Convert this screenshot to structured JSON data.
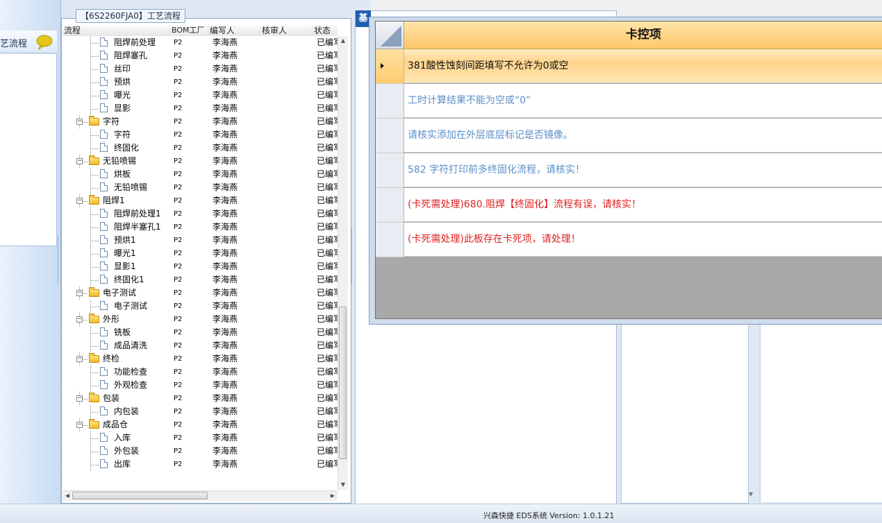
{
  "left_nav": {
    "item_label": "艺流程"
  },
  "process_panel": {
    "title": "【6S2260FJA0】工艺流程",
    "columns": [
      "流程",
      "BOM工厂",
      "编写人",
      "核审人",
      "状态"
    ],
    "rows": [
      {
        "type": "leaf",
        "label": "阻焊前处理",
        "bom": "P2",
        "writer": "李海燕",
        "status": "已编写"
      },
      {
        "type": "leaf",
        "label": "阻焊塞孔",
        "bom": "P2",
        "writer": "李海燕",
        "status": "已编写"
      },
      {
        "type": "leaf",
        "label": "丝印",
        "bom": "P2",
        "writer": "李海燕",
        "status": "已编写"
      },
      {
        "type": "leaf",
        "label": "预烘",
        "bom": "P2",
        "writer": "李海燕",
        "status": "已编写"
      },
      {
        "type": "leaf",
        "label": "曝光",
        "bom": "P2",
        "writer": "李海燕",
        "status": "已编写"
      },
      {
        "type": "leaf",
        "label": "显影",
        "bom": "P2",
        "writer": "李海燕",
        "status": "已编写"
      },
      {
        "type": "folder",
        "label": "字符",
        "bom": "P2",
        "writer": "李海燕",
        "status": "已编写"
      },
      {
        "type": "leaf",
        "label": "字符",
        "bom": "P2",
        "writer": "李海燕",
        "status": "已编写"
      },
      {
        "type": "leaf",
        "label": "终固化",
        "bom": "P2",
        "writer": "李海燕",
        "status": "已编写"
      },
      {
        "type": "folder",
        "label": "无铅喷锡",
        "bom": "P2",
        "writer": "李海燕",
        "status": "已编写"
      },
      {
        "type": "leaf",
        "label": "烘板",
        "bom": "P2",
        "writer": "李海燕",
        "status": "已编写"
      },
      {
        "type": "leaf",
        "label": "无铅喷锡",
        "bom": "P2",
        "writer": "李海燕",
        "status": "已编写"
      },
      {
        "type": "folder",
        "label": "阻焊1",
        "bom": "P2",
        "writer": "李海燕",
        "status": "已编写"
      },
      {
        "type": "leaf",
        "label": "阻焊前处理1",
        "bom": "P2",
        "writer": "李海燕",
        "status": "已编写"
      },
      {
        "type": "leaf",
        "label": "阻焊半塞孔1",
        "bom": "P2",
        "writer": "李海燕",
        "status": "已编写"
      },
      {
        "type": "leaf",
        "label": "预烘1",
        "bom": "P2",
        "writer": "李海燕",
        "status": "已编写"
      },
      {
        "type": "leaf",
        "label": "曝光1",
        "bom": "P2",
        "writer": "李海燕",
        "status": "已编写"
      },
      {
        "type": "leaf",
        "label": "显影1",
        "bom": "P2",
        "writer": "李海燕",
        "status": "已编写"
      },
      {
        "type": "leaf",
        "label": "终固化1",
        "bom": "P2",
        "writer": "李海燕",
        "status": "已编写"
      },
      {
        "type": "folder",
        "label": "电子测试",
        "bom": "P2",
        "writer": "李海燕",
        "status": "已编写"
      },
      {
        "type": "leaf",
        "label": "电子测试",
        "bom": "P2",
        "writer": "李海燕",
        "status": "已编写"
      },
      {
        "type": "folder",
        "label": "外形",
        "bom": "P2",
        "writer": "李海燕",
        "status": "已编写"
      },
      {
        "type": "leaf",
        "label": "铣板",
        "bom": "P2",
        "writer": "李海燕",
        "status": "已编写"
      },
      {
        "type": "leaf",
        "label": "成品清洗",
        "bom": "P2",
        "writer": "李海燕",
        "status": "已编写"
      },
      {
        "type": "folder",
        "label": "终检",
        "bom": "P2",
        "writer": "李海燕",
        "status": "已编写"
      },
      {
        "type": "leaf",
        "label": "功能检查",
        "bom": "P2",
        "writer": "李海燕",
        "status": "已编写"
      },
      {
        "type": "leaf",
        "label": "外观检查",
        "bom": "P2",
        "writer": "李海燕",
        "status": "已编写"
      },
      {
        "type": "folder",
        "label": "包装",
        "bom": "P2",
        "writer": "李海燕",
        "status": "已编写"
      },
      {
        "type": "leaf",
        "label": "内包装",
        "bom": "P2",
        "writer": "李海燕",
        "status": "已编写"
      },
      {
        "type": "folder",
        "label": "成品仓",
        "bom": "P2",
        "writer": "李海燕",
        "status": "已编写"
      },
      {
        "type": "leaf",
        "label": "入库",
        "bom": "P2",
        "writer": "李海燕",
        "status": "已编写"
      },
      {
        "type": "leaf",
        "label": "外包装",
        "bom": "P2",
        "writer": "李海燕",
        "status": "已编写"
      },
      {
        "type": "leaf",
        "label": "出库",
        "bom": "P2",
        "writer": "李海燕",
        "status": "已编写"
      }
    ]
  },
  "mid_panel": {
    "tab_label": "基"
  },
  "control_dialog": {
    "header": "卡控项",
    "items": [
      {
        "text": "381酸性蚀刻间距填写不允许为0或空",
        "color": "#111111",
        "selected": true
      },
      {
        "text": "工时计算结果不能为空或“0”",
        "color": "#5b8fc8",
        "selected": false
      },
      {
        "text": "请核实添加在外层底层标记是否镜像。",
        "color": "#5b8fc8",
        "selected": false
      },
      {
        "text": "582 字符打印前多终固化流程，请核实！",
        "color": "#5b8fc8",
        "selected": false
      },
      {
        "text": "(卡死需处理)680.阻焊【终固化】流程有误，请核实！",
        "color": "#e02020",
        "selected": false
      },
      {
        "text": "(卡死需处理)此板存在卡死项，请处理！",
        "color": "#e02020",
        "selected": false
      }
    ]
  },
  "status_bar": {
    "text": "兴森快捷 EDS系统 Version: 1.0.1.21"
  }
}
